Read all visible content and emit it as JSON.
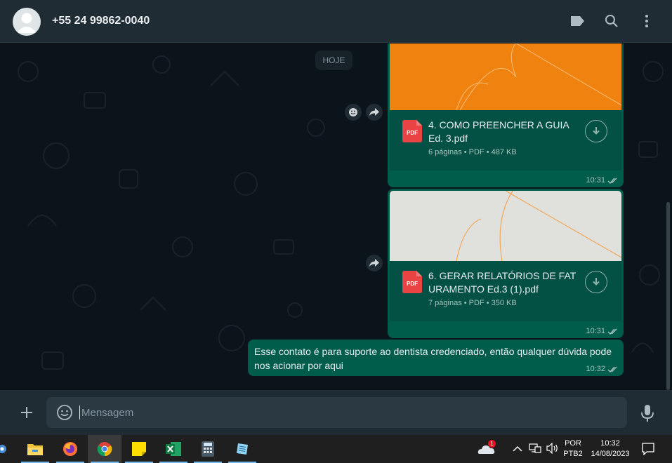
{
  "header": {
    "contact": "+55 24 99862-0040",
    "icons": [
      "label-icon",
      "search-icon",
      "more-vert-icon"
    ]
  },
  "chat": {
    "date_chip": "HOJE",
    "messages": [
      {
        "type": "file",
        "file_name": "4. COMO PREENCHER A GUIA Ed. 3.pdf",
        "file_meta": "6 páginas • PDF • 487 KB",
        "file_type": "PDF",
        "time": "10:31",
        "preview_color": "#f0820f"
      },
      {
        "type": "file",
        "file_name": "6. GERAR RELATÓRIOS DE FATURAMENTO Ed.3 (1).pdf",
        "file_meta": "7 páginas • PDF • 350 KB",
        "file_type": "PDF",
        "time": "10:31",
        "preview_color": "#e0e0dc"
      },
      {
        "type": "text",
        "text": "Esse contato é para suporte ao dentista credenciado, então qualquer dúvida pode nos acionar por aqui",
        "time": "10:32"
      }
    ]
  },
  "composer": {
    "placeholder": "Mensagem"
  },
  "taskbar": {
    "apps": [
      "file-explorer",
      "firefox",
      "chrome",
      "sticky-notes",
      "excel",
      "calculator",
      "notepad"
    ],
    "active_app": "chrome",
    "onedrive_badge": "1",
    "language_top": "POR",
    "language_bottom": "PTB2",
    "time": "10:32",
    "date": "14/08/2023"
  },
  "colors": {
    "header_bg": "#202c33",
    "chat_bg": "#0b141a",
    "outgoing_bubble": "#005c4b",
    "accent_orange": "#f0820f",
    "pdf_red": "#e94343"
  }
}
